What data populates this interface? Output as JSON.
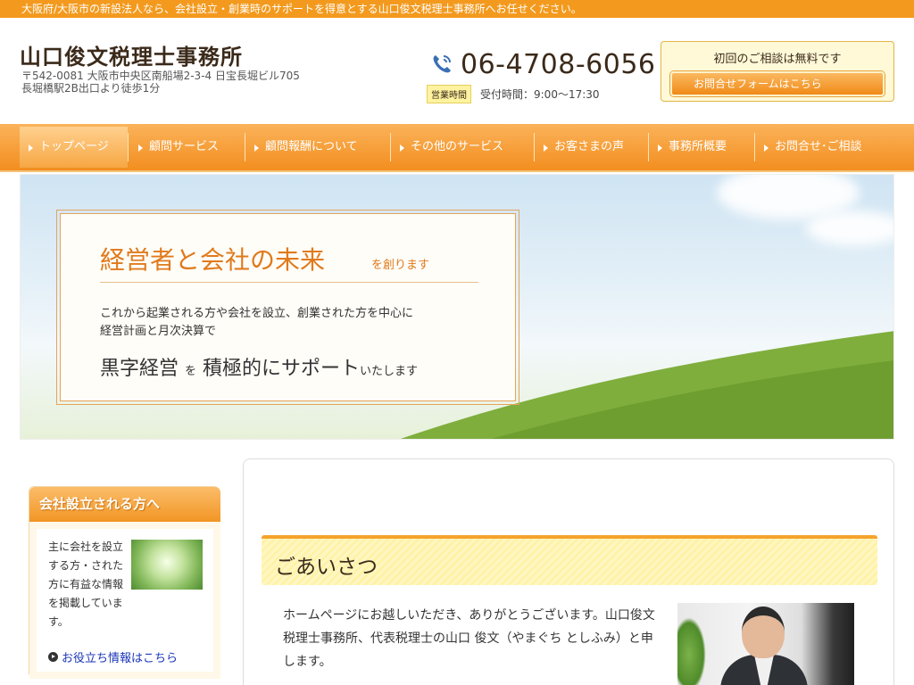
{
  "topbar": {
    "text": "大阪府/大阪市の新設法人なら、会社設立・創業時のサポートを得意とする山口俊文税理士事務所へお任せください。"
  },
  "header": {
    "logo": "山口俊文税理士事務所",
    "address_line1": "〒542-0081 大阪市中央区南船場2-3-4 日宝長堀ビル705",
    "address_line2": "長堀橋駅2B出口より徒歩1分",
    "phone": "06-4708-6056",
    "hours_badge": "営業時間",
    "hours_text": "受付時間：9:00〜17:30",
    "cta_title": "初回のご相談は無料です",
    "cta_button": "お問合せフォームはこちら"
  },
  "nav": {
    "items": [
      {
        "label": "トップページ"
      },
      {
        "label": "顧問サービス"
      },
      {
        "label": "顧問報酬について"
      },
      {
        "label": "その他のサービス"
      },
      {
        "label": "お客さまの声"
      },
      {
        "label": "事務所概要"
      },
      {
        "label": "お問合せ･ご相談"
      }
    ]
  },
  "hero": {
    "headline": "経営者と会社の未来",
    "headline_suffix": "を創ります",
    "text_line1": "これから起業される方や会社を設立、創業された方を中心に",
    "text_line2": "経営計画と月次決算で",
    "big_part1": "黒字経営",
    "big_part2": "を",
    "big_part3": "積極的にサポート",
    "big_part4": "いたします"
  },
  "sidebar": {
    "title": "会社設立される方へ",
    "text": "主に会社を設立する方・された方に有益な情報を掲載しています。",
    "link": "お役立ち情報はこちら"
  },
  "main": {
    "greeting_title": "ごあいさつ",
    "greeting_text": "ホームページにお越しいただき、ありがとうございます。山口俊文税理士事務所、代表税理士の山口 俊文（やまぐち としふみ）と申します。"
  },
  "colors": {
    "accent": "#f39a1e",
    "link": "#1a35b8",
    "heading_orange": "#e07a1c"
  }
}
